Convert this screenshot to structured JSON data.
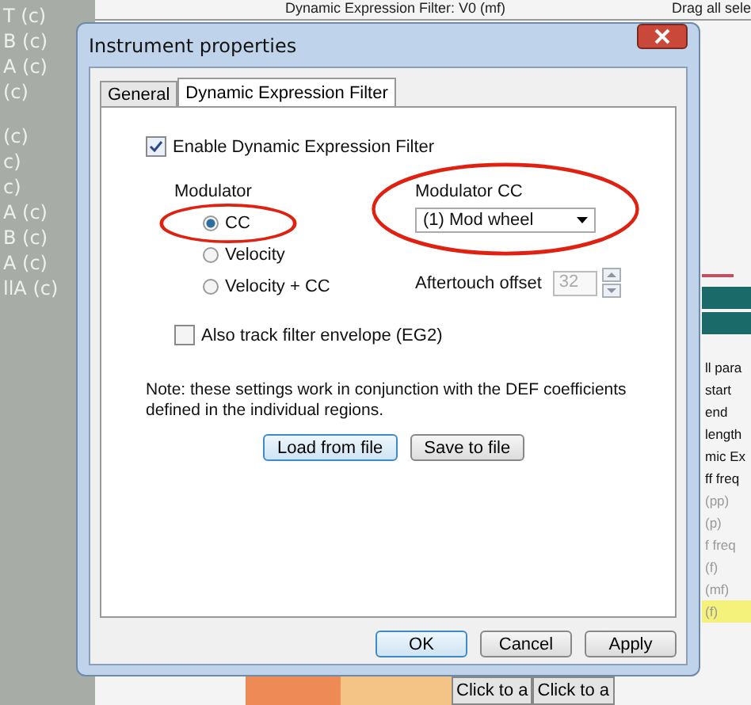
{
  "background": {
    "left_list": [
      "T (c)",
      "B (c)",
      "A (c)",
      "(c)",
      "(c)",
      "c)",
      "c)",
      "A (c)",
      "B (c)",
      "A (c)",
      "llA (c)"
    ],
    "header": {
      "filter_title": "Dynamic Expression Filter: V0 (mf)",
      "drag_label": "Drag all sele"
    },
    "right_list": [
      "ll para",
      "start",
      "end",
      "length",
      "mic Ex",
      "ff freq",
      "(pp)",
      "(p)",
      "f freq",
      "(f)",
      "(mf)",
      "(f)"
    ],
    "footer_buttons": [
      "Click to a",
      "Click to a"
    ]
  },
  "dialog": {
    "title": "Instrument properties",
    "tabs": [
      {
        "label": "General",
        "selected": false
      },
      {
        "label": "Dynamic Expression Filter",
        "selected": true
      }
    ],
    "enable": {
      "label": "Enable Dynamic Expression Filter",
      "checked": true
    },
    "modulator": {
      "label": "Modulator",
      "options": [
        {
          "label": "CC",
          "selected": true
        },
        {
          "label": "Velocity",
          "selected": false
        },
        {
          "label": "Velocity + CC",
          "selected": false
        }
      ]
    },
    "modulator_cc": {
      "label": "Modulator CC",
      "value": "(1) Mod wheel"
    },
    "aftertouch": {
      "label": "Aftertouch offset",
      "value": "32",
      "disabled": true
    },
    "track_env": {
      "label": "Also track filter envelope (EG2)",
      "checked": false
    },
    "note": "Note: these settings work in conjunction with the DEF coefficients defined in the individual regions.",
    "file_buttons": [
      {
        "label": "Load from file",
        "default": true
      },
      {
        "label": "Save to file",
        "default": false
      }
    ],
    "buttons": [
      {
        "label": "OK",
        "default": true
      },
      {
        "label": "Cancel",
        "default": false
      },
      {
        "label": "Apply",
        "default": false
      }
    ]
  }
}
